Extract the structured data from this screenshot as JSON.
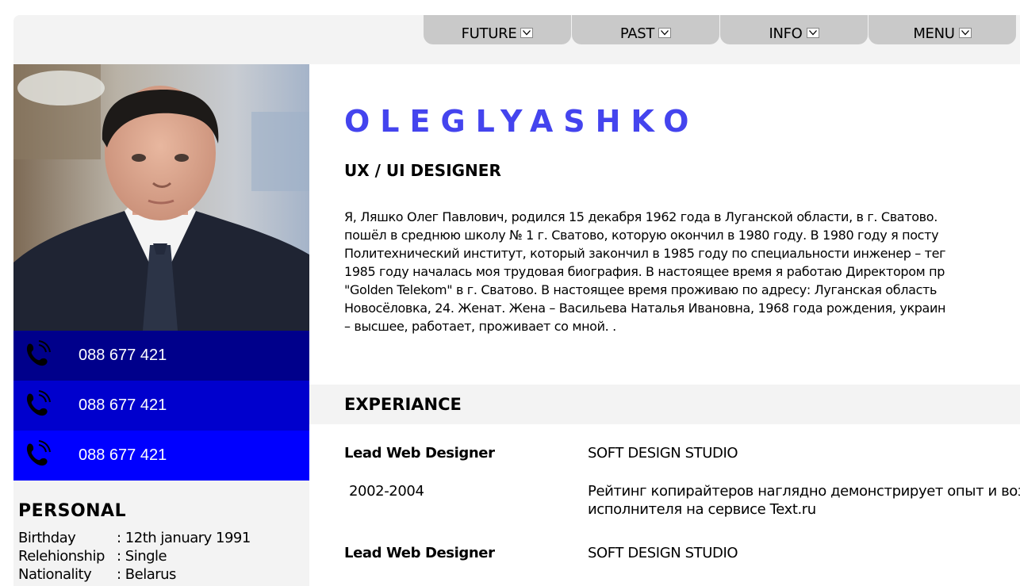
{
  "nav": {
    "tabs": [
      {
        "label": "FUTURE",
        "icon": "chevron-down-icon"
      },
      {
        "label": "PAST",
        "icon": "chevron-down-icon"
      },
      {
        "label": "INFO",
        "icon": "chevron-down-icon"
      },
      {
        "label": "MENU",
        "icon": "chevron-down-icon"
      }
    ]
  },
  "sidebar": {
    "photo_icon": "profile-photo",
    "phones": [
      {
        "number": "088 677 421",
        "icon": "phone-icon",
        "bg": "#00008b"
      },
      {
        "number": "088 677 421",
        "icon": "phone-icon",
        "bg": "#0000cd"
      },
      {
        "number": "088 677 421",
        "icon": "phone-icon",
        "bg": "#0000ff"
      }
    ],
    "personal": {
      "title": "PERSONAL",
      "rows": [
        {
          "key": "Birthday",
          "value": ": 12th january 1991"
        },
        {
          "key": "Relehionship",
          "value": ": Single"
        },
        {
          "key": "Nationality",
          "value": ": Belarus"
        }
      ]
    }
  },
  "main": {
    "name": "OLEGLYASHKO",
    "role": "UX / UI DESIGNER",
    "bio_lines": [
      "Я, Ляшко Олег Павлович, родился 15 декабря 1962 года в Луганской области, в г. Сватово.",
      "пошёл в среднюю школу № 1 г. Сватово, которую окончил в 1980 году. В 1980 году я посту",
      "Политехнический институт, который закончил в 1985 году по специальности инженер – тег",
      "1985 году началась моя трудовая биография. В настоящее время я работаю Директором пр",
      "\"Golden Telekom\" в г. Сватово. В настоящее время проживаю по адресу: Луганская область",
      "Новосёловка, 24. Женат. Жена – Васильева Наталья Ивановна, 1968 года рождения, украин",
      "– высшее, работает, проживает со мной. ."
    ],
    "experience": {
      "title": "EXPERIANCE",
      "entries": [
        {
          "position": "Lead Web Designer",
          "company": "SOFT DESIGN STUDIO",
          "years": "2002-2004",
          "description_lines": [
            "Рейтинг копирайтеров наглядно демонстрирует опыт и воз",
            "исполнителя на сервисе Text.ru"
          ]
        },
        {
          "position": "Lead Web Designer",
          "company": "SOFT DESIGN STUDIO"
        }
      ]
    }
  },
  "colors": {
    "accent": "#4444ee",
    "panel": "#f3f3f3",
    "tab": "#c9c9c9"
  }
}
